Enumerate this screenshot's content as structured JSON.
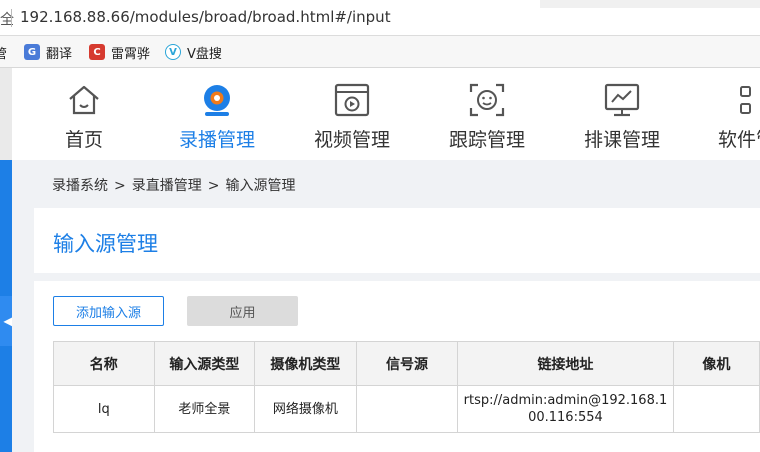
{
  "browser": {
    "url_prefix": "全",
    "url": "192.168.88.66/modules/broad/broad.html#/input",
    "bookmarks": [
      {
        "label": "管",
        "icon": "none"
      },
      {
        "label": "翻译",
        "icon": "translate-icon"
      },
      {
        "label": "雷霄骅",
        "icon": "csdn-icon"
      },
      {
        "label": "V盘搜",
        "icon": "v-icon"
      }
    ]
  },
  "nav": {
    "items": [
      {
        "label": "首页",
        "icon": "home-icon",
        "active": false
      },
      {
        "label": "录播管理",
        "icon": "webcam-icon",
        "active": true
      },
      {
        "label": "视频管理",
        "icon": "video-window-icon",
        "active": false
      },
      {
        "label": "跟踪管理",
        "icon": "face-tracking-icon",
        "active": false
      },
      {
        "label": "排课管理",
        "icon": "monitor-chart-icon",
        "active": false
      },
      {
        "label": "软件管",
        "icon": "apps-grid-icon",
        "active": false
      }
    ]
  },
  "breadcrumb": {
    "items": [
      "录播系统",
      "录直播管理",
      "输入源管理"
    ],
    "separator": ">"
  },
  "page": {
    "title": "输入源管理",
    "add_button": "添加输入源",
    "apply_button": "应用"
  },
  "table": {
    "headers": [
      "名称",
      "输入源类型",
      "摄像机类型",
      "信号源",
      "链接地址",
      "像机"
    ],
    "rows": [
      [
        "lq",
        "老师全景",
        "网络摄像机",
        "",
        "rtsp://admin:admin@192.168.100.116:554",
        ""
      ]
    ]
  },
  "colors": {
    "accent": "#1d7fe6",
    "sidebar": "#1d7fe6",
    "content_bg": "#f0f2f5"
  }
}
